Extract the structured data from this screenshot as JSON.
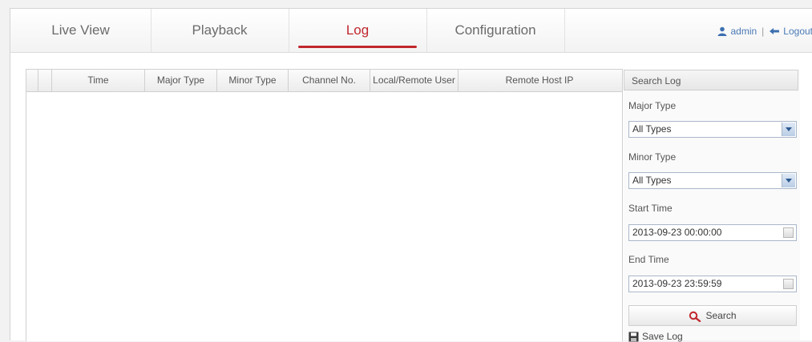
{
  "nav": {
    "tabs": [
      {
        "label": "Live View"
      },
      {
        "label": "Playback"
      },
      {
        "label": "Log"
      },
      {
        "label": "Configuration"
      }
    ],
    "active_tab": "Log",
    "user": "admin",
    "separator": "|",
    "logout_label": "Logout"
  },
  "log_table": {
    "columns": [
      "Time",
      "Major Type",
      "Minor Type",
      "Channel No.",
      "Local/Remote User",
      "Remote Host IP"
    ],
    "rows": []
  },
  "search_panel": {
    "title": "Search Log",
    "major_type_label": "Major Type",
    "major_type_value": "All Types",
    "minor_type_label": "Minor Type",
    "minor_type_value": "All Types",
    "start_time_label": "Start Time",
    "start_time_value": "2013-09-23 00:00:00",
    "end_time_label": "End Time",
    "end_time_value": "2013-09-23 23:59:59",
    "search_label": "Search",
    "save_log_label": "Save Log"
  },
  "colors": {
    "accent": "#c0272d",
    "link": "#4a7ab5",
    "tab_text": "#6b6b6b"
  }
}
